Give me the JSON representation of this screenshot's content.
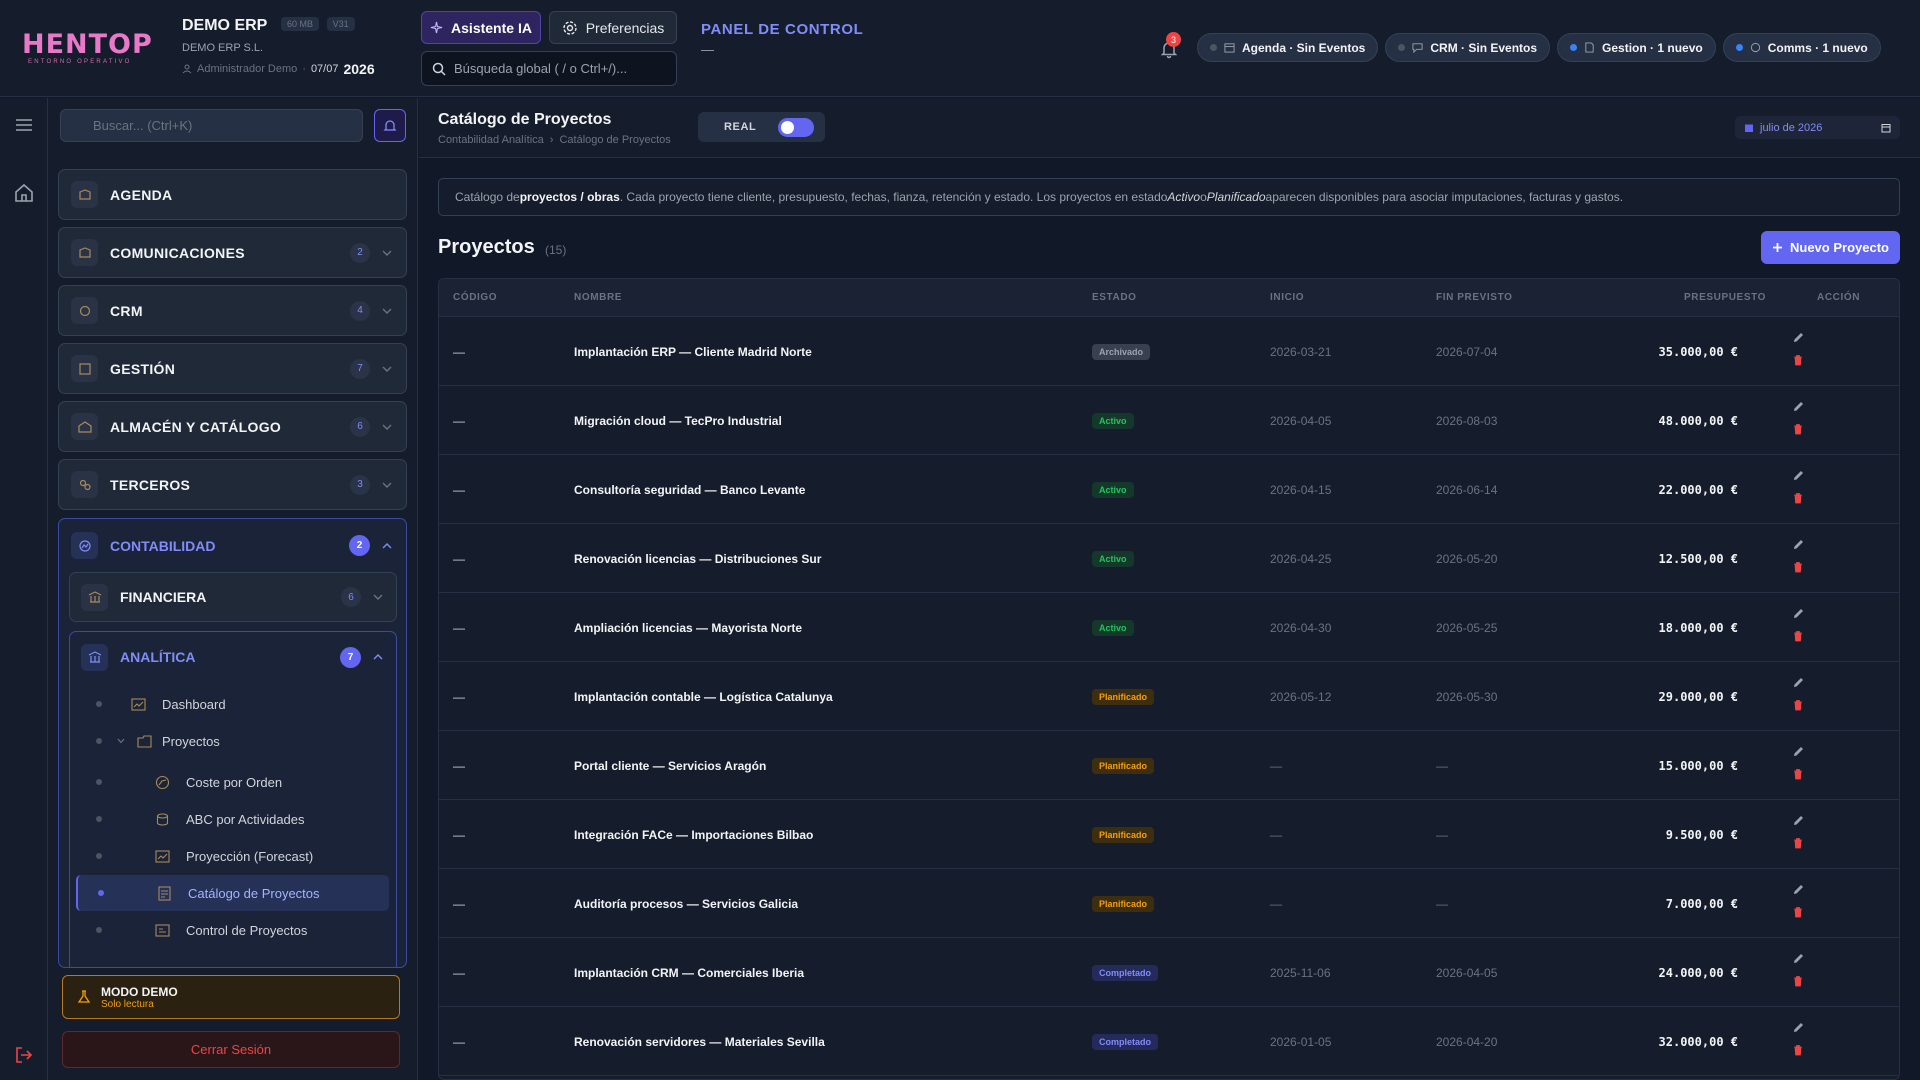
{
  "header": {
    "logo_text": "HENTOP",
    "logo_sub": "ENTORNO OPERATIVO",
    "app_name": "DEMO ERP",
    "badge_mb": "60 MB",
    "badge_version": "V31",
    "company": "DEMO ERP S.L.",
    "user": "Administrador Demo",
    "date": "07/07",
    "year": "2026",
    "ai_button": "Asistente IA",
    "prefs_button": "Preferencias",
    "search_placeholder": "Búsqueda global ( / o Ctrl+/)...",
    "panel_title": "PANEL DE CONTROL",
    "panel_sub": "—",
    "notif_count": "3",
    "chips": [
      {
        "label": "Agenda · Sin Eventos",
        "dot": "#4b5563"
      },
      {
        "label": "CRM · Sin Eventos",
        "dot": "#4b5563"
      },
      {
        "label": "Gestion · 1 nuevo",
        "dot": "#3b82f6"
      },
      {
        "label": "Comms · 1 nuevo",
        "dot": "#3b82f6"
      }
    ]
  },
  "sidebar": {
    "search_placeholder": "Buscar... (Ctrl+K)",
    "modules": [
      {
        "label": "AGENDA",
        "count": ""
      },
      {
        "label": "COMUNICACIONES",
        "count": "2"
      },
      {
        "label": "CRM",
        "count": "4"
      },
      {
        "label": "GESTIÓN",
        "count": "7"
      },
      {
        "label": "ALMACÉN Y CATÁLOGO",
        "count": "6"
      },
      {
        "label": "TERCEROS",
        "count": "3"
      }
    ],
    "contabilidad": {
      "label": "CONTABILIDAD",
      "count": "2"
    },
    "financiera": {
      "label": "FINANCIERA",
      "count": "6"
    },
    "analitica": {
      "label": "ANALÍTICA",
      "count": "7"
    },
    "leaves": [
      {
        "label": "Dashboard"
      },
      {
        "label": "Proyectos"
      },
      {
        "label": "Coste por Orden"
      },
      {
        "label": "ABC por Actividades"
      },
      {
        "label": "Proyección (Forecast)"
      },
      {
        "label": "Catálogo de Proyectos"
      },
      {
        "label": "Control de Proyectos"
      }
    ],
    "demo_title": "MODO DEMO",
    "demo_sub": "Solo lectura",
    "logout": "Cerrar Sesión"
  },
  "page": {
    "title": "Catálogo de Proyectos",
    "breadcrumb": [
      "Contabilidad Analítica",
      "Catálogo de Proyectos"
    ],
    "real_label": "REAL",
    "date_filter": "julio de 2026",
    "info_pre": "Catálogo de ",
    "info_bold": "proyectos / obras",
    "info_mid": ". Cada proyecto tiene cliente, presupuesto, fechas, fianza, retención y estado. Los proyectos en estado ",
    "info_i1": "Activo",
    "info_o": " o ",
    "info_i2": "Planificado",
    "info_post": " aparecen disponibles para asociar imputaciones, facturas y gastos.",
    "section_title": "Proyectos",
    "section_count": "(15)",
    "new_button": "Nuevo Proyecto"
  },
  "table": {
    "columns": [
      "CÓDIGO",
      "NOMBRE",
      "ESTADO",
      "INICIO",
      "FIN PREVISTO",
      "PRESUPUESTO",
      "ACCIÓN"
    ],
    "rows": [
      {
        "code": "—",
        "name": "Implantación ERP — Cliente Madrid Norte",
        "status": "Archivado",
        "start": "2026-03-21",
        "end": "2026-07-04",
        "budget": "35.000,00 €"
      },
      {
        "code": "—",
        "name": "Migración cloud — TecPro Industrial",
        "status": "Activo",
        "start": "2026-04-05",
        "end": "2026-08-03",
        "budget": "48.000,00 €"
      },
      {
        "code": "—",
        "name": "Consultoría seguridad — Banco Levante",
        "status": "Activo",
        "start": "2026-04-15",
        "end": "2026-06-14",
        "budget": "22.000,00 €"
      },
      {
        "code": "—",
        "name": "Renovación licencias — Distribuciones Sur",
        "status": "Activo",
        "start": "2026-04-25",
        "end": "2026-05-20",
        "budget": "12.500,00 €"
      },
      {
        "code": "—",
        "name": "Ampliación licencias — Mayorista Norte",
        "status": "Activo",
        "start": "2026-04-30",
        "end": "2026-05-25",
        "budget": "18.000,00 €"
      },
      {
        "code": "—",
        "name": "Implantación contable — Logística Catalunya",
        "status": "Planificado",
        "start": "2026-05-12",
        "end": "2026-05-30",
        "budget": "29.000,00 €"
      },
      {
        "code": "—",
        "name": "Portal cliente — Servicios Aragón",
        "status": "Planificado",
        "start": "—",
        "end": "—",
        "budget": "15.000,00 €"
      },
      {
        "code": "—",
        "name": "Integración FACe — Importaciones Bilbao",
        "status": "Planificado",
        "start": "—",
        "end": "—",
        "budget": "9.500,00 €"
      },
      {
        "code": "—",
        "name": "Auditoría procesos — Servicios Galicia",
        "status": "Planificado",
        "start": "—",
        "end": "—",
        "budget": "7.000,00 €"
      },
      {
        "code": "—",
        "name": "Implantación CRM — Comerciales Iberia",
        "status": "Completado",
        "start": "2025-11-06",
        "end": "2026-04-05",
        "budget": "24.000,00 €"
      },
      {
        "code": "—",
        "name": "Renovación servidores — Materiales Sevilla",
        "status": "Completado",
        "start": "2026-01-05",
        "end": "2026-04-20",
        "budget": "32.000,00 €"
      }
    ]
  },
  "status_colors": {
    "Archivado": {
      "bg": "#374151",
      "fg": "#9ca3af"
    },
    "Activo": {
      "bg": "#14382a",
      "fg": "#22c55e"
    },
    "Planificado": {
      "bg": "#3d2e10",
      "fg": "#f59e0b"
    },
    "Completado": {
      "bg": "#252a5c",
      "fg": "#818cf8"
    }
  }
}
